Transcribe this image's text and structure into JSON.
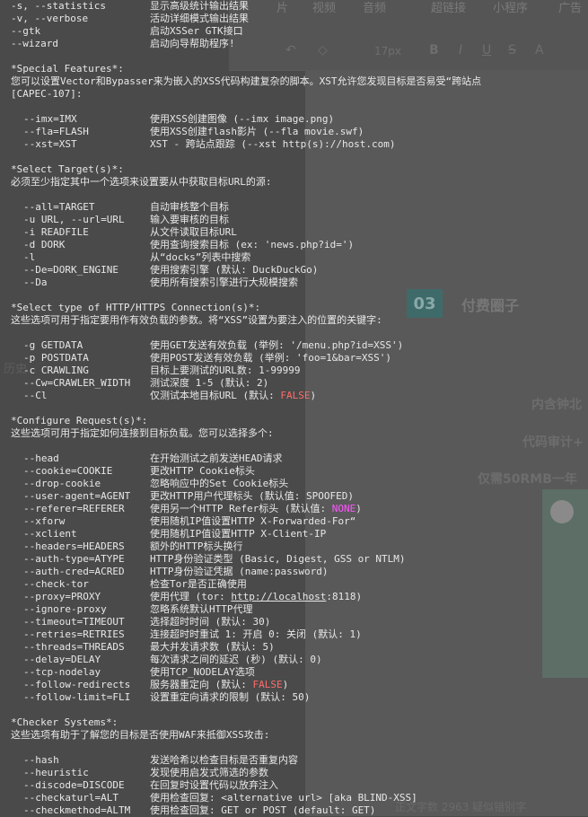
{
  "background": {
    "menu": [
      "片",
      "视频",
      "音频",
      "超链接",
      "小程序",
      "广告"
    ],
    "format_bar": {
      "font_size": "17px",
      "bold": "B",
      "italic": "I",
      "underline": "U",
      "strike": "S",
      "color": "A"
    },
    "badge": "03",
    "heading": "付费圈子",
    "lines": [
      "内含钟北",
      "代码审计+",
      "仅需50RMB一年"
    ],
    "side_text": "历史",
    "footer": "正文字数 2963  疑似错别字"
  },
  "terminal": {
    "top_options": [
      {
        "opt": "-s, --statistics",
        "desc": "显示高级统计输出结果"
      },
      {
        "opt": "-v, --verbose",
        "desc": "活动详细模式输出结果"
      },
      {
        "opt": "--gtk",
        "desc": "启动XSSer GTK接口"
      },
      {
        "opt": "--wizard",
        "desc": "启动向导帮助程序!"
      }
    ],
    "special": {
      "header": "*Special Features*:",
      "intro": "  您可以设置Vector和Bypasser来为嵌入的XSS代码构建复杂的脚本。XST允许您发现目标是否易受“跨站点",
      "intro2": "  [CAPEC-107]:",
      "options": [
        {
          "opt": "--imx=IMX",
          "desc": "使用XSS创建图像 (--imx image.png)"
        },
        {
          "opt": "--fla=FLASH",
          "desc": "使用XSS创建flash影片 (--fla movie.swf)"
        },
        {
          "opt": "--xst=XST",
          "desc": "XST - 跨站点跟踪 (--xst http(s)://host.com)"
        }
      ]
    },
    "target": {
      "header": "*Select Target(s)*:",
      "intro": "  必须至少指定其中一个选项来设置要从中获取目标URL的源:",
      "options": [
        {
          "opt": "--all=TARGET",
          "desc": "自动审核整个目标"
        },
        {
          "opt": "-u URL, --url=URL",
          "desc": "输入要审核的目标"
        },
        {
          "opt": "-i READFILE",
          "desc": "从文件读取目标URL"
        },
        {
          "opt": "-d DORK",
          "desc": "使用查询搜索目标 (ex: 'news.php?id=')"
        },
        {
          "opt": "-l",
          "desc": "从“docks”列表中搜索"
        },
        {
          "opt": "--De=DORK_ENGINE",
          "desc": "使用搜索引擎 (默认: DuckDuckGo)"
        },
        {
          "opt": "--Da",
          "desc": "使用所有搜索引擎进行大规模搜索"
        }
      ]
    },
    "connection": {
      "header": "*Select type of HTTP/HTTPS Connection(s)*:",
      "intro": "  这些选项可用于指定要用作有效负载的参数。将“XSS”设置为要注入的位置的关键字:",
      "options": [
        {
          "opt": "-g GETDATA",
          "desc": "使用GET发送有效负载 (举例: '/menu.php?id=XSS')"
        },
        {
          "opt": "-p POSTDATA",
          "desc": "使用POST发送有效负载 (举例: 'foo=1&bar=XSS')"
        },
        {
          "opt": "-c CRAWLING",
          "desc": "目标上要测试的URL数: 1-99999"
        },
        {
          "opt": "--Cw=CRAWLER_WIDTH",
          "desc": "测试深度 1-5 (默认: 2)"
        },
        {
          "opt": "--Cl",
          "desc_pre": "仅测试本地目标URL (默认: ",
          "desc_hl": "FALSE",
          "desc_post": ")"
        }
      ]
    },
    "request": {
      "header": "*Configure Request(s)*:",
      "intro": "  这些选项可用于指定如何连接到目标负载。您可以选择多个:",
      "options": [
        {
          "opt": "--head",
          "desc": "在开始测试之前发送HEAD请求"
        },
        {
          "opt": "--cookie=COOKIE",
          "desc": "更改HTTP Cookie标头"
        },
        {
          "opt": "--drop-cookie",
          "desc": "忽略响应中的Set Cookie标头"
        },
        {
          "opt": "--user-agent=AGENT",
          "desc": "更改HTTP用户代理标头 (默认值: SPOOFED)"
        },
        {
          "opt": "--referer=REFERER",
          "desc_pre": "使用另一个HTTP Refer标头 (默认值: ",
          "desc_hl": "NONE",
          "desc_post": ")"
        },
        {
          "opt": "--xforw",
          "desc": "使用随机IP值设置HTTP X-Forwarded-For“"
        },
        {
          "opt": "--xclient",
          "desc": "使用随机IP值设置HTTP X-Client-IP"
        },
        {
          "opt": "--headers=HEADERS",
          "desc": "额外的HTTP标头换行"
        },
        {
          "opt": "--auth-type=ATYPE",
          "desc": "HTTP身份验证类型 (Basic, Digest, GSS or NTLM)"
        },
        {
          "opt": "--auth-cred=ACRED",
          "desc": "HTTP身份验证凭据 (name:password)"
        },
        {
          "opt": "--check-tor",
          "desc": "检查Tor是否正确使用"
        },
        {
          "opt": "--proxy=PROXY",
          "desc_pre": "使用代理 (tor: ",
          "desc_link": "http://localhost",
          "desc_post": ":8118)"
        },
        {
          "opt": "--ignore-proxy",
          "desc": "忽略系统默认HTTP代理"
        },
        {
          "opt": "--timeout=TIMEOUT",
          "desc": "选择超时时间 (默认: 30)"
        },
        {
          "opt": "--retries=RETRIES",
          "desc": "连接超时时重试 1: 开启  0: 关闭 (默认: 1)"
        },
        {
          "opt": "--threads=THREADS",
          "desc": "最大并发请求数 (默认: 5)"
        },
        {
          "opt": "--delay=DELAY",
          "desc": "每次请求之间的延迟 (秒) (默认: 0)"
        },
        {
          "opt": "--tcp-nodelay",
          "desc": "使用TCP_NODELAY选项"
        },
        {
          "opt": "--follow-redirects",
          "desc_pre": "服务器重定向 (默认: ",
          "desc_hl": "FALSE",
          "desc_post": ")"
        },
        {
          "opt": "--follow-limit=FLI",
          "desc": "设置重定向请求的限制 (默认: 50)"
        }
      ]
    },
    "checker": {
      "header": "*Checker Systems*:",
      "intro": "  这些选项有助于了解您的目标是否使用WAF来抵御XSS攻击:",
      "options": [
        {
          "opt": "--hash",
          "desc": "发送哈希以检查目标是否重复内容"
        },
        {
          "opt": "--heuristic",
          "desc": "发现使用启发式筛选的参数"
        },
        {
          "opt": "--discode=DISCODE",
          "desc": "在回复时设置代码以放弃注入"
        },
        {
          "opt": "--checkaturl=ALT",
          "desc": "使用检查回复: <alternative url> [aka BLIND-XSS]"
        },
        {
          "opt": "--checkmethod=ALTM",
          "desc": "使用检查回复: GET or POST (default: GET)"
        }
      ]
    },
    "colors": {
      "text": "#e8e8e8",
      "false_value": "#ff6b6b",
      "none_value": "#ff55ff"
    }
  }
}
